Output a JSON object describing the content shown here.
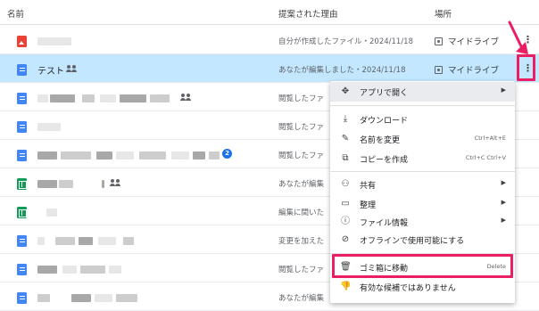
{
  "header": {
    "name": "名前",
    "reason": "提案された理由",
    "location": "場所"
  },
  "rows": [
    {
      "reason": "自分が作成したファイル・2024/11/18",
      "location": "マイドライブ"
    },
    {
      "name": "テスト",
      "reason": "あなたが編集しました・2024/11/18",
      "location": "マイドライブ"
    },
    {
      "reason": "閲覧したファ"
    },
    {
      "reason": "閲覧したファ"
    },
    {
      "reason": "閲覧したファ",
      "badge": "2"
    },
    {
      "reason": "あなたが編集"
    },
    {
      "reason": "編集に間いた"
    },
    {
      "reason": "変更を加えた"
    },
    {
      "reason": "閲覧したファ"
    },
    {
      "reason": "あなたが編集"
    }
  ],
  "menu": {
    "open_with": "アプリで開く",
    "download": "ダウンロード",
    "rename": "名前を変更",
    "rename_shortcut": "Ctrl+Alt+E",
    "copy": "コピーを作成",
    "copy_shortcut": "Ctrl+C Ctrl+V",
    "share": "共有",
    "organize": "整理",
    "file_info": "ファイル情報",
    "offline": "オフラインで使用可能にする",
    "trash": "ゴミ箱に移動",
    "trash_shortcut": "Delete",
    "not_useful": "有効な候補ではありません"
  },
  "colors": {
    "selected_row": "#c2e7ff",
    "highlight": "#e91e63",
    "doc_icon": "#4285f4",
    "sheet_icon": "#0f9d58",
    "image_icon": "#ea4335"
  }
}
